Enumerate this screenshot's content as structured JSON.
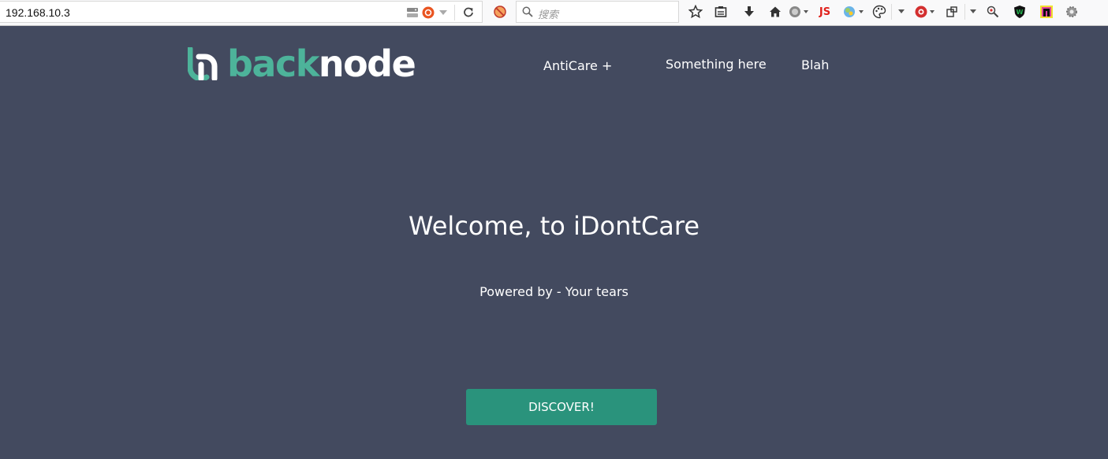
{
  "browser": {
    "url": "192.168.10.3",
    "search_placeholder": "搜索",
    "toolbar_icons": [
      "bookmark-star-icon",
      "reading-list-icon",
      "download-icon",
      "home-icon",
      "addon-globe-icon",
      "js-icon",
      "addon-color-icon",
      "palette-icon",
      "addon-red-icon",
      "window-icon",
      "search-zoom-icon",
      "shield-icon",
      "addon-n-icon",
      "settings-icon"
    ],
    "js_badge": "JS",
    "colors": {
      "js_badge": "#e0201b",
      "shield": "#21b14b"
    }
  },
  "site": {
    "logo": {
      "part1": "back",
      "part2": "node",
      "accent": "#4db39a"
    },
    "nav": [
      {
        "label": "AntiCare +"
      },
      {
        "label": "Something here"
      },
      {
        "label": "Blah"
      }
    ],
    "hero": {
      "title": "Welcome, to iDontCare",
      "subtitle": "Powered by - Your tears",
      "cta": "DISCOVER!"
    },
    "colors": {
      "background": "#434a5f",
      "cta": "#2a937c"
    }
  }
}
